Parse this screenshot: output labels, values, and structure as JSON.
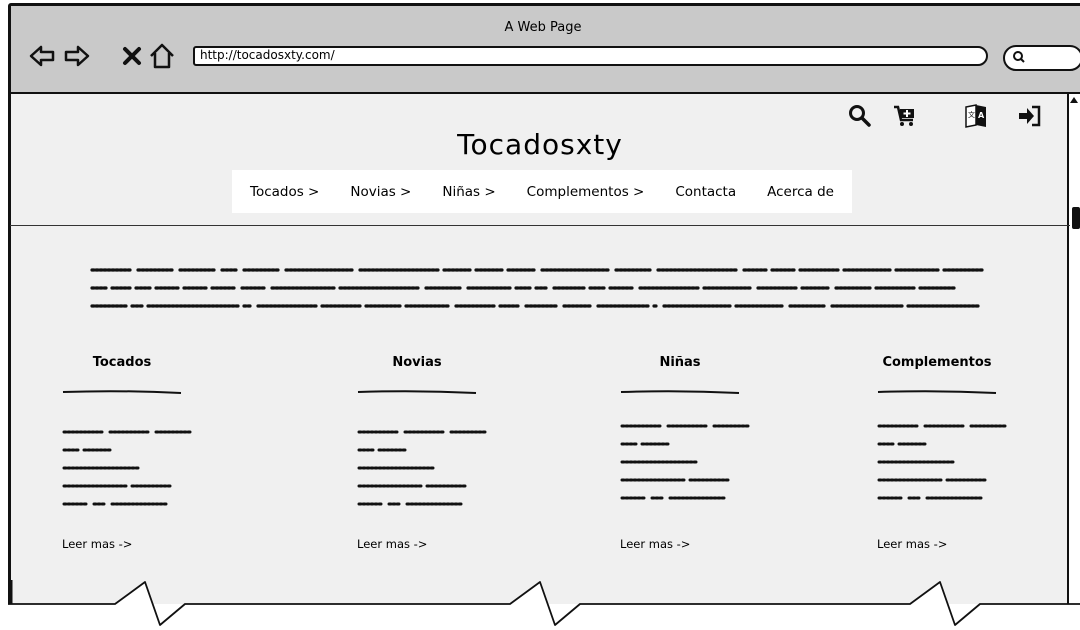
{
  "browser": {
    "window_title": "A Web Page",
    "url": "http://tocadosxty.com/"
  },
  "site": {
    "title": "Tocadosxty",
    "menu": [
      "Tocados >",
      "Novias >",
      "Niñas >",
      "Complementos >",
      "Contacta",
      "Acerca de"
    ],
    "top_icons": [
      "search-icon",
      "cart-icon",
      "translate-icon",
      "login-icon"
    ]
  },
  "columns": [
    {
      "title": "Tocados",
      "link": "Leer mas ->"
    },
    {
      "title": "Novias",
      "link": "Leer mas ->"
    },
    {
      "title": "Niñas",
      "link": "Leer mas ->"
    },
    {
      "title": "Complementos",
      "link": "Leer mas ->"
    }
  ]
}
